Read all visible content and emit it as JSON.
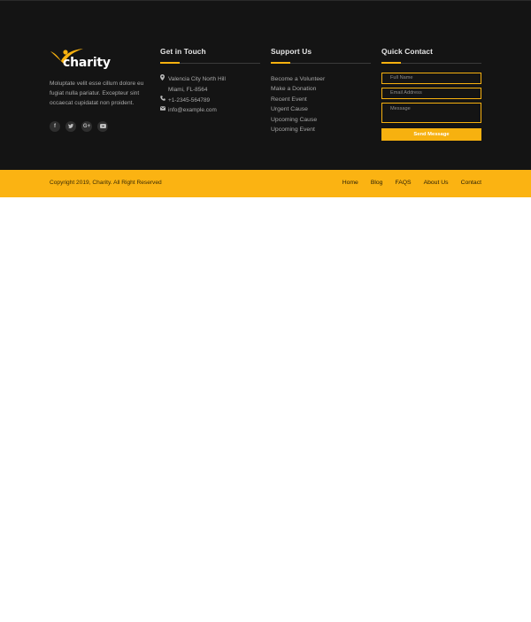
{
  "brand": {
    "name": "charity",
    "accent": "#f7b10f",
    "footer_bg": "#141414",
    "bar_bg": "#fbb312"
  },
  "about": {
    "text": "Moluptate velit esse cillum dolore eu fugiat nulla pariatur. Excepteur sint occaecat cupidatat non proident."
  },
  "social": [
    {
      "icon": "facebook-icon",
      "glyph": "f"
    },
    {
      "icon": "twitter-icon",
      "glyph": "✔"
    },
    {
      "icon": "google-plus-icon",
      "glyph": "G+"
    },
    {
      "icon": "youtube-icon",
      "glyph": "▶"
    }
  ],
  "get_in_touch": {
    "title": "Get in Touch",
    "address_line1": "Valencia City North Hill",
    "address_line2": "Miami, FL-8564",
    "phone": "+1-2345-564789",
    "email": "info@example.com"
  },
  "support": {
    "title": "Support Us",
    "links": [
      "Become a Volunteer",
      "Make a Donation",
      "Recent Event",
      "Urgent Cause",
      "Upcoming Cause",
      "Upcoming Event"
    ]
  },
  "quick_contact": {
    "title": "Quick Contact",
    "name_placeholder": "Full Name",
    "email_placeholder": "Email Address",
    "message_placeholder": "Message",
    "send_label": "Send Message"
  },
  "bottom_bar": {
    "copyright": "Copyright 2019, Charity. All Right Reserved",
    "nav": [
      "Home",
      "Blog",
      "FAQS",
      "About Us",
      "Contact"
    ]
  }
}
